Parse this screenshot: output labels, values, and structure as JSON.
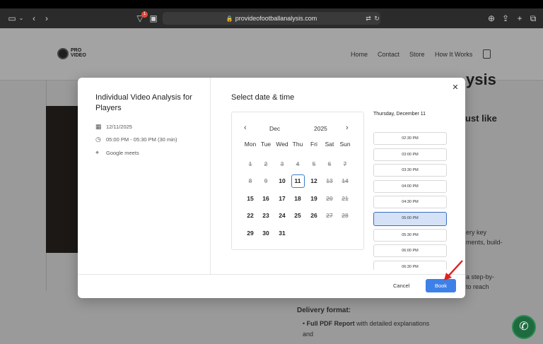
{
  "browser": {
    "url": "provideofootballanalysis.com",
    "badge_count": "1"
  },
  "site": {
    "logo_text": "PRO\nVIDEO",
    "nav": [
      "Home",
      "Contact",
      "Store",
      "How It Works"
    ],
    "bg_heading1": "ysis",
    "bg_heading2": "ust like",
    "bg_lines": [
      "ery key",
      "ments, build-",
      "a step-by-",
      "to reach"
    ],
    "delivery_heading": "Delivery format:",
    "bullet1_bold": "Full PDF Report",
    "bullet1_rest": "with detailed explanations",
    "and_text": "and"
  },
  "modal": {
    "service_title": "Individual Video Analysis for Players",
    "date": "12/11/2025",
    "time": "05:00 PM - 05:30 PM (30 min)",
    "location": "Google meets",
    "select_title": "Select date & time",
    "calendar": {
      "month": "Dec",
      "year": "2025",
      "weekdays": [
        "Mon",
        "Tue",
        "Wed",
        "Thu",
        "Fri",
        "Sat",
        "Sun"
      ],
      "weeks": [
        [
          "1",
          "2",
          "3",
          "4",
          "5",
          "6",
          "7"
        ],
        [
          "8",
          "9",
          "10",
          "11",
          "12",
          "13",
          "14"
        ],
        [
          "15",
          "16",
          "17",
          "18",
          "19",
          "20",
          "21"
        ],
        [
          "22",
          "23",
          "24",
          "25",
          "26",
          "27",
          "28"
        ],
        [
          "29",
          "30",
          "31",
          "",
          "",
          "",
          ""
        ]
      ],
      "selected_day": "11"
    },
    "selected_date_label": "Thursday, December 11",
    "slots": [
      "02:30 PM",
      "03:00 PM",
      "03:30 PM",
      "04:00 PM",
      "04:30 PM",
      "05:00 PM",
      "05:30 PM",
      "06:00 PM",
      "06:30 PM"
    ],
    "selected_slot": "05:00 PM",
    "cancel_label": "Cancel",
    "book_label": "Book"
  },
  "colors": {
    "accent": "#3d80e8",
    "selected_slot_bg": "#d4e1f7",
    "arrow": "#e02020"
  }
}
